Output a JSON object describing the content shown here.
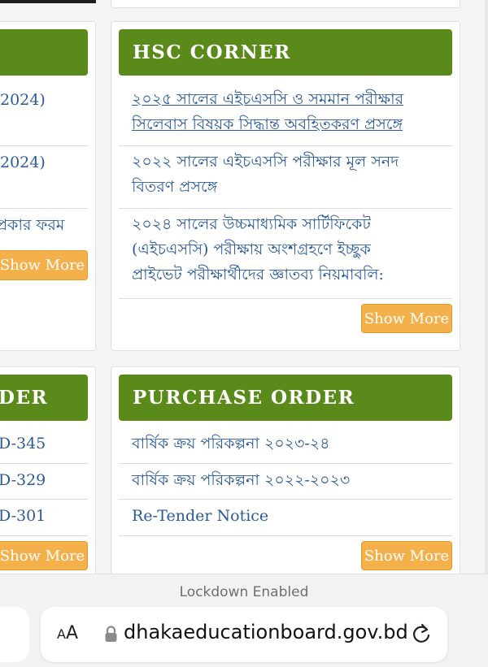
{
  "left_column": {
    "top_card": {
      "items": [
        "2024)",
        "2024)",
        "প্রকার ফরম"
      ],
      "show_more": "Show More"
    },
    "bottom_card": {
      "header": "DER",
      "items": [
        "D-345",
        "D-329",
        "D-301"
      ],
      "show_more": "Show More"
    }
  },
  "hsc_corner": {
    "header": "HSC CORNER",
    "items": [
      "২০২৫ সালের এইচএসসি ও সমমান পরীক্ষার সিলেবাস বিষয়ক সিদ্ধান্ত অবহিতকরণ প্রসঙ্গে",
      "২০২২ সালের এইচএসসি পরীক্ষার মূল সনদ বিতরণ প্রসঙ্গে",
      "২০২৪ সালের উচ্চমাধ্যমিক সার্টিফিকেট (এইচএসসি) পরীক্ষায় অংশগ্রহণে ইচ্ছুক প্রাইভেট পরীক্ষার্থীদের জ্ঞাতব্য নিয়মাবলি:"
    ],
    "item1_lines": [
      "২০২৫ সালের এইচএসসি ও সমমান পরীক্ষার",
      "সিলেবাস বিষয়ক সিদ্ধান্ত অবহিতকরণ প্রসঙ্গে"
    ],
    "item2_lines": [
      "২০২২ সালের এইচএসসি পরীক্ষার মূল সনদ",
      "বিতরণ প্রসঙ্গে"
    ],
    "item3_lines": [
      "২০২৪ সালের উচ্চমাধ্যমিক সার্টিফিকেট",
      "(এইচএসসি) পরীক্ষায় অংশগ্রহণে ইচ্ছুক",
      "প্রাইভেট পরীক্ষার্থীদের জ্ঞাতব্য নিয়মাবলি:"
    ],
    "show_more": "Show More"
  },
  "purchase_order": {
    "header": "PURCHASE ORDER",
    "items": [
      "বার্ষিক ক্রয় পরিকল্পনা ২০২৩-২৪",
      "বার্ষিক ক্রয় পরিকল্পনা ২০২২-২০২৩",
      "Re-Tender Notice"
    ],
    "show_more": "Show More"
  },
  "browser": {
    "lockdown_text": "Lockdown Enabled",
    "aa_label_small": "A",
    "aa_label_large": "A",
    "url": "dhakaeducationboard.gov.bd",
    "icons": [
      "lock-icon",
      "reload-icon"
    ]
  },
  "colors": {
    "header_green": "#5a8a1a",
    "link_blue": "#2a5a9a",
    "show_more_orange": "#f4b04a"
  }
}
